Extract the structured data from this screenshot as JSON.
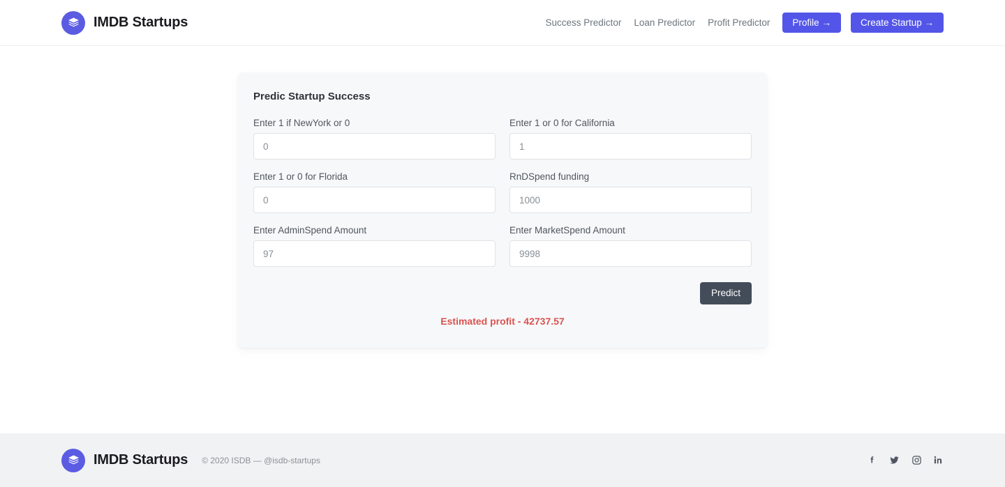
{
  "brand": {
    "name": "IMDB Startups",
    "logo_icon": "layers-stack-icon",
    "accent_color": "#5b5ce2"
  },
  "nav": {
    "links": [
      {
        "label": "Success Predictor"
      },
      {
        "label": "Loan Predictor"
      },
      {
        "label": "Profit Predictor"
      }
    ],
    "buttons": [
      {
        "label": "Profile →"
      },
      {
        "label": "Create Startup →"
      }
    ],
    "button_color": "#5355e8"
  },
  "card": {
    "title": "Predic Startup Success",
    "fields": [
      {
        "label": "Enter 1 if NewYork or 0",
        "value": "0",
        "placeholder": "0"
      },
      {
        "label": "Enter 1 or 0 for California",
        "value": "1",
        "placeholder": "1"
      },
      {
        "label": "Enter 1 or 0 for Florida",
        "value": "0",
        "placeholder": "0"
      },
      {
        "label": "RnDSpend funding",
        "value": "1000",
        "placeholder": "1000"
      },
      {
        "label": "Enter AdminSpend Amount",
        "value": "97",
        "placeholder": "97"
      },
      {
        "label": "Enter MarketSpend Amount",
        "value": "9998",
        "placeholder": "9998"
      }
    ],
    "submit_label": "Predict",
    "submit_color": "#434c59",
    "result_text": "Estimated profit - 42737.57",
    "result_color": "#d9534f"
  },
  "footer": {
    "brand_name": "IMDB Startups",
    "copyright": "© 2020 ISDB — @isdb-startups",
    "socials": [
      {
        "name": "facebook-icon"
      },
      {
        "name": "twitter-icon"
      },
      {
        "name": "instagram-icon"
      },
      {
        "name": "linkedin-icon"
      }
    ]
  }
}
